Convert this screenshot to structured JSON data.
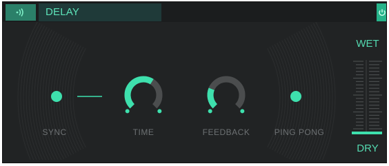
{
  "header": {
    "title": "DELAY",
    "module_icon": "waves-icon",
    "power_icon": "power-icon"
  },
  "controls": {
    "sync": {
      "label": "SYNC",
      "on": true
    },
    "time": {
      "label": "TIME",
      "level": 0.62
    },
    "feedback": {
      "label": "FEEDBACK",
      "level": 0.25
    },
    "ping_pong": {
      "label": "PING PONG",
      "on": true
    }
  },
  "mix": {
    "wet_label": "WET",
    "dry_label": "DRY",
    "level": 0.0
  },
  "colors": {
    "accent": "#3ee0ad",
    "panel": "#212324",
    "knob_track": "#4b4d4e"
  }
}
